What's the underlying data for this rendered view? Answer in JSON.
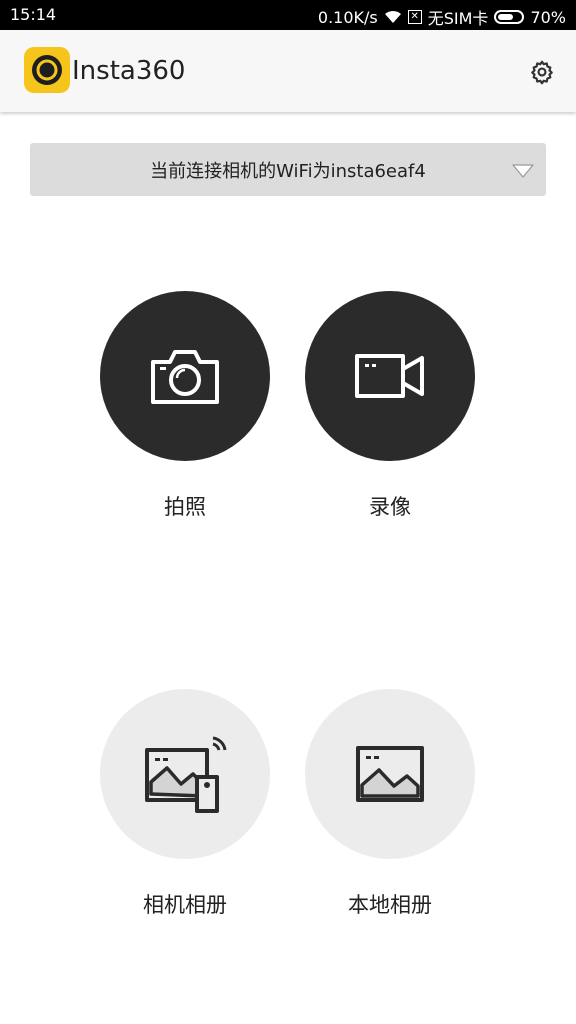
{
  "status_bar": {
    "time": "15:14",
    "speed": "0.10K/s",
    "sim": "无SIM卡",
    "battery": "70%",
    "battery_level": 0.7,
    "sim_icon_glyph": "✕"
  },
  "app_bar": {
    "title": "Insta360",
    "logo_icon": "insta360-logo-icon",
    "settings_icon": "gear-icon"
  },
  "wifi_selector": {
    "label": "当前连接相机的WiFi为insta6eaf4"
  },
  "actions": {
    "photo": {
      "label": "拍照",
      "icon": "camera-icon"
    },
    "video": {
      "label": "录像",
      "icon": "video-camera-icon"
    },
    "camera_album": {
      "label": "相机相册",
      "icon": "camera-album-icon"
    },
    "local_album": {
      "label": "本地相册",
      "icon": "local-album-icon"
    }
  },
  "colors": {
    "status_bar_bg": "#000000",
    "app_bar_bg": "#f7f7f7",
    "logo_yellow": "#f6c51b",
    "dropdown_bg": "#dcdcdc",
    "dark_circle": "#2b2b2b",
    "light_circle": "#ececec",
    "text": "#222222"
  }
}
